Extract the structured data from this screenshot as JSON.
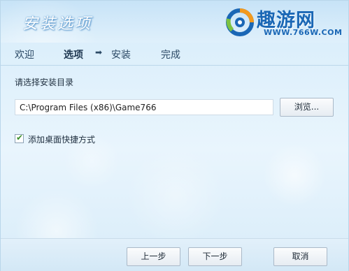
{
  "window": {
    "title": "安装选项"
  },
  "logo": {
    "name": "趣游网",
    "url": "WWW.766W.COM"
  },
  "steps": [
    {
      "label": "欢迎"
    },
    {
      "label": "选项"
    },
    {
      "label": "安装"
    },
    {
      "label": "完成"
    }
  ],
  "steps_arrow": "➡",
  "install_dir": {
    "label": "请选择安装目录",
    "path": "C:\\Program Files (x86)\\Game766",
    "browse_label": "浏览..."
  },
  "shortcut": {
    "label": "添加桌面快捷方式",
    "checked": true
  },
  "footer": {
    "prev_label": "上一步",
    "next_label": "下一步",
    "cancel_label": "取消"
  },
  "colors": {
    "brand": "#1a67b5",
    "accent_check": "#3a8f2a"
  }
}
